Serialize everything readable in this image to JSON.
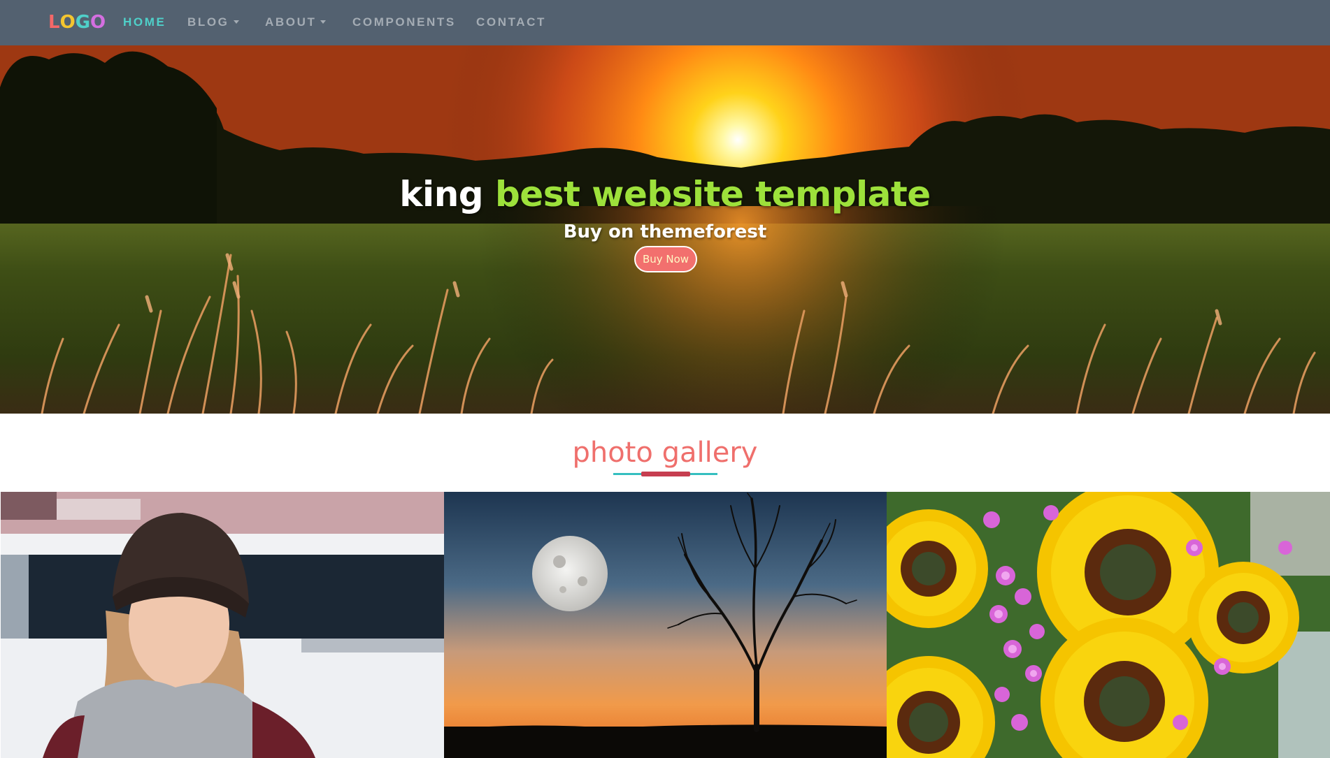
{
  "nav": {
    "logo_letters": [
      "L",
      "O",
      "G",
      "O"
    ],
    "logo_colors": [
      "#f56868",
      "#f4c52f",
      "#4fd0c9",
      "#d46fe0"
    ],
    "items": [
      {
        "label": "HOME",
        "active": true,
        "has_dropdown": false
      },
      {
        "label": "BLOG",
        "active": false,
        "has_dropdown": true
      },
      {
        "label": "ABOUT",
        "active": false,
        "has_dropdown": true
      },
      {
        "label": "COMPONENTS",
        "active": false,
        "has_dropdown": false
      },
      {
        "label": "CONTACT",
        "active": false,
        "has_dropdown": false
      }
    ],
    "active_color": "#4fd0c9",
    "background_color": "#536170"
  },
  "hero": {
    "title_white": "king",
    "title_green": "best website template",
    "subtitle": "Buy on themeforest",
    "button_label": "Buy Now",
    "green_color": "#9de13b",
    "button_color": "#f2706e"
  },
  "gallery": {
    "title": "photo gallery",
    "title_color": "#ef6f6c",
    "photos": [
      {
        "name": "woman-in-beanie-photo"
      },
      {
        "name": "moon-and-tree-sunset-photo"
      },
      {
        "name": "sunflower-bouquet-photo"
      }
    ]
  }
}
